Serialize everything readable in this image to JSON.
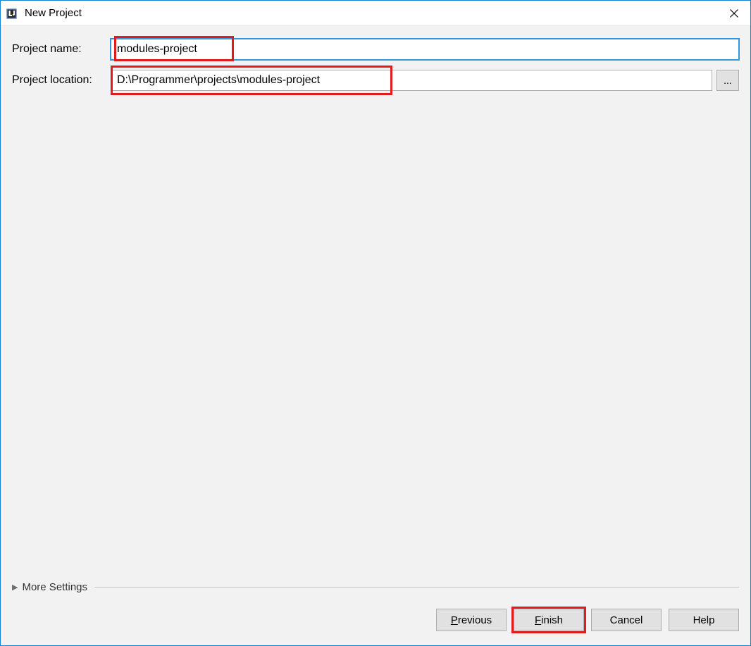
{
  "window": {
    "title": "New Project"
  },
  "form": {
    "project_name_label": "Project name:",
    "project_name_value": "modules-project",
    "project_location_label": "Project location:",
    "project_location_value": "D:\\Programmer\\projects\\modules-project",
    "browse_button_label": "..."
  },
  "more_settings": {
    "label": "More Settings"
  },
  "buttons": {
    "previous": "Previous",
    "finish": "Finish",
    "cancel": "Cancel",
    "help": "Help"
  }
}
